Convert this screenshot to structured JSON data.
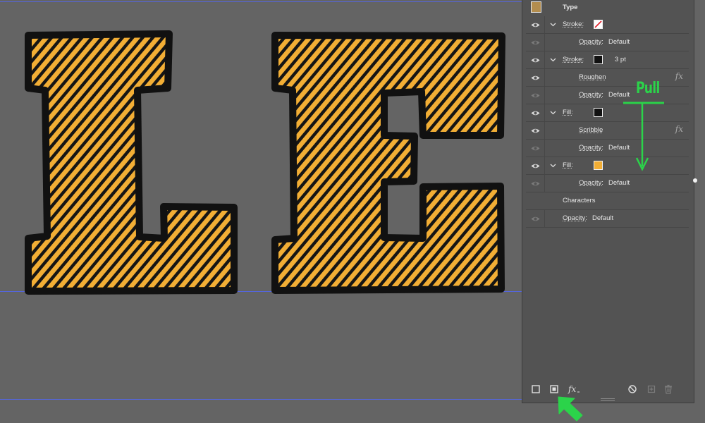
{
  "panel": {
    "type_label": "Type",
    "stroke1_label": "Stroke:",
    "opacity_label": "Opacity:",
    "opacity_value": "Default",
    "stroke2_label": "Stroke:",
    "stroke2_weight": "3 pt",
    "roughen_label": "Roughen",
    "fill1_label": "Fill:",
    "scribble_label": "Scribble",
    "fill2_label": "Fill:",
    "characters_label": "Characters",
    "fx_glyph": "fx"
  },
  "annotation": {
    "pull_text": "Pull"
  },
  "colors": {
    "letter_fill": "#f2ae35",
    "letter_outline": "#111111",
    "annotation": "#2bd34a",
    "type_swatch": "#b38d4e",
    "fill_swatch": "#f2ae35",
    "guide": "#5566dd"
  }
}
